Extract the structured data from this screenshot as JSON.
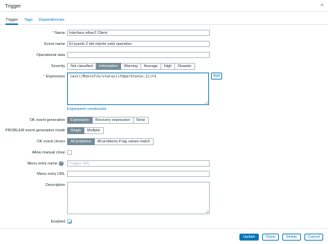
{
  "window": {
    "title": "Trigger",
    "close_glyph": "×"
  },
  "tabs": [
    {
      "label": "Trigger"
    },
    {
      "label": "Tags"
    },
    {
      "label": "Dependencies"
    }
  ],
  "form": {
    "required_marker": "*",
    "name": {
      "label": "Name",
      "value": "Interface ether2 Client"
    },
    "event_name": {
      "label": "Event name",
      "value": "El puerto 2 del cliente está operativo"
    },
    "operational_data": {
      "label": "Operational data",
      "value": ""
    },
    "severity": {
      "label": "Severity",
      "options": [
        "Not classified",
        "Information",
        "Warning",
        "Average",
        "High",
        "Disaster"
      ],
      "selected": "Information"
    },
    "expression": {
      "label": "Expression",
      "value": "last(/MikroTik/status[ifOperStatus.2])=1",
      "add_button": "Add",
      "constructor_link": "Expression constructor"
    },
    "ok_event_generation": {
      "label": "OK event generation",
      "options": [
        "Expression",
        "Recovery expression",
        "None"
      ],
      "selected": "Expression"
    },
    "problem_event_mode": {
      "label": "PROBLEM event generation mode",
      "options": [
        "Single",
        "Multiple"
      ],
      "selected": "Single"
    },
    "ok_event_closes": {
      "label": "OK event closes",
      "options": [
        "All problems",
        "All problems if tag values match"
      ],
      "selected": "All problems"
    },
    "allow_manual_close": {
      "label": "Allow manual close",
      "checked": false
    },
    "menu_entry_name": {
      "label": "Menu entry name",
      "placeholder": "Trigger URL",
      "help_glyph": "?"
    },
    "menu_entry_url": {
      "label": "Menu entry URL",
      "value": ""
    },
    "description": {
      "label": "Description",
      "value": ""
    },
    "enabled": {
      "label": "Enabled",
      "checked": true
    }
  },
  "footer": {
    "update": "Update",
    "clone": "Clone",
    "delete": "Delete",
    "cancel": "Cancel"
  },
  "colors": {
    "accent": "#0275b8",
    "segment_selected": "#768d99",
    "required": "#e45959",
    "border": "#acbbc2"
  }
}
